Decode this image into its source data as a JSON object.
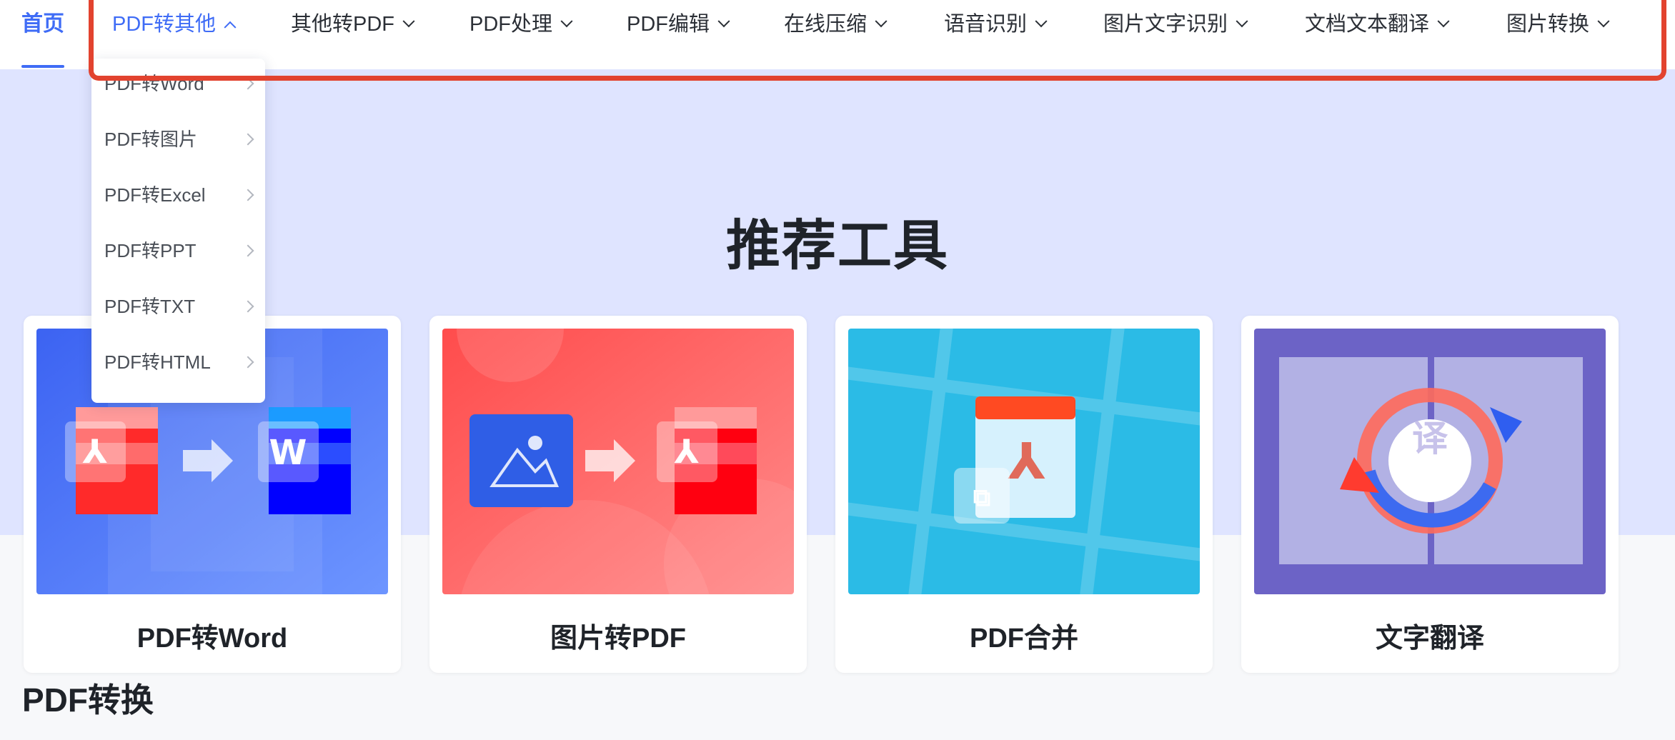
{
  "nav": {
    "home": "首页",
    "items": [
      {
        "label": "PDF转其他",
        "expanded": true
      },
      {
        "label": "其他转PDF"
      },
      {
        "label": "PDF处理"
      },
      {
        "label": "PDF编辑"
      },
      {
        "label": "在线压缩"
      },
      {
        "label": "语音识别"
      },
      {
        "label": "图片文字识别"
      },
      {
        "label": "文档文本翻译"
      },
      {
        "label": "图片转换"
      }
    ]
  },
  "dropdown": {
    "items": [
      "PDF转Word",
      "PDF转图片",
      "PDF转Excel",
      "PDF转PPT",
      "PDF转TXT",
      "PDF转HTML"
    ]
  },
  "hero": {
    "title": "推荐工具"
  },
  "cards": [
    {
      "label": "PDF转Word",
      "illustration": "pdf-to-word-illustration"
    },
    {
      "label": "图片转PDF",
      "illustration": "image-to-pdf-illustration"
    },
    {
      "label": "PDF合并",
      "illustration": "pdf-merge-illustration"
    },
    {
      "label": "文字翻译",
      "illustration": "text-translate-illustration",
      "badge": "译"
    }
  ],
  "section": {
    "title": "PDF转换"
  },
  "colors": {
    "accent": "#3f6cf6",
    "hero_bg": "#dfe4ff",
    "highlight_border": "#e2432f",
    "card_word_bg": "#4f78f5",
    "card_image_bg": "#ff5f5f",
    "card_merge_bg": "#2bbbe6",
    "card_translate_bg": "#6c63c6"
  }
}
